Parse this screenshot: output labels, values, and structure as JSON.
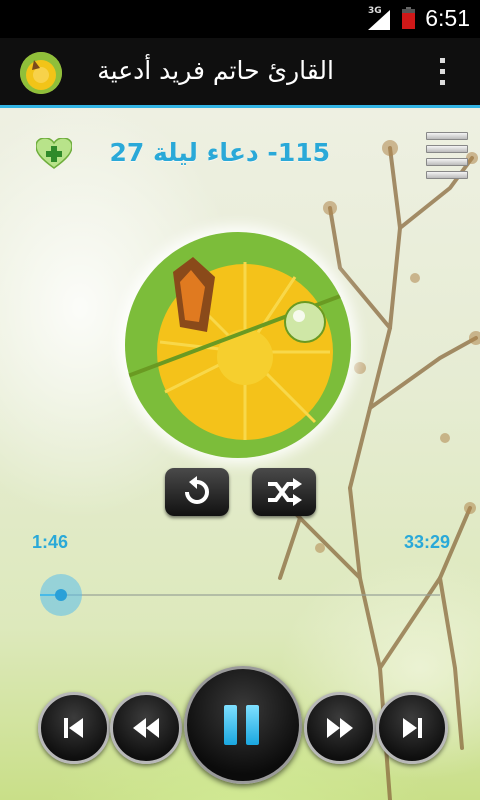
{
  "status_bar": {
    "network": "3G",
    "time": "6:51"
  },
  "action_bar": {
    "title": "القارئ حاتم فريد أدعية"
  },
  "player": {
    "track_title": "115- دعاء ليلة 27",
    "elapsed": "1:46",
    "total": "33:29",
    "progress_fraction": 0.053,
    "state": "playing"
  },
  "colors": {
    "accent": "#33b5e5",
    "title_text": "#2aa9d8"
  },
  "icons": {
    "favorite_add": "heart-plus-icon",
    "playlist": "list-icon",
    "repeat": "repeat-icon",
    "shuffle": "shuffle-icon",
    "previous": "skip-previous-icon",
    "rewind": "rewind-icon",
    "pause": "pause-icon",
    "fast_forward": "fast-forward-icon",
    "next": "skip-next-icon",
    "overflow": "overflow-menu-icon"
  }
}
